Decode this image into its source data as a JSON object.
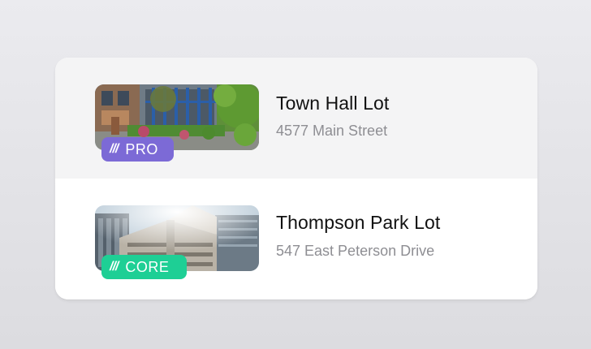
{
  "lots": [
    {
      "name": "Town Hall Lot",
      "address": "4577 Main Street",
      "tier": "PRO",
      "tier_mark": "///",
      "tier_color": "#7c6ad6",
      "image": "courtyard-building-photo"
    },
    {
      "name": "Thompson Park Lot",
      "address": "547 East Peterson Drive",
      "tier": "CORE",
      "tier_mark": "///",
      "tier_color": "#1ecf95",
      "image": "parking-garage-photo"
    }
  ]
}
